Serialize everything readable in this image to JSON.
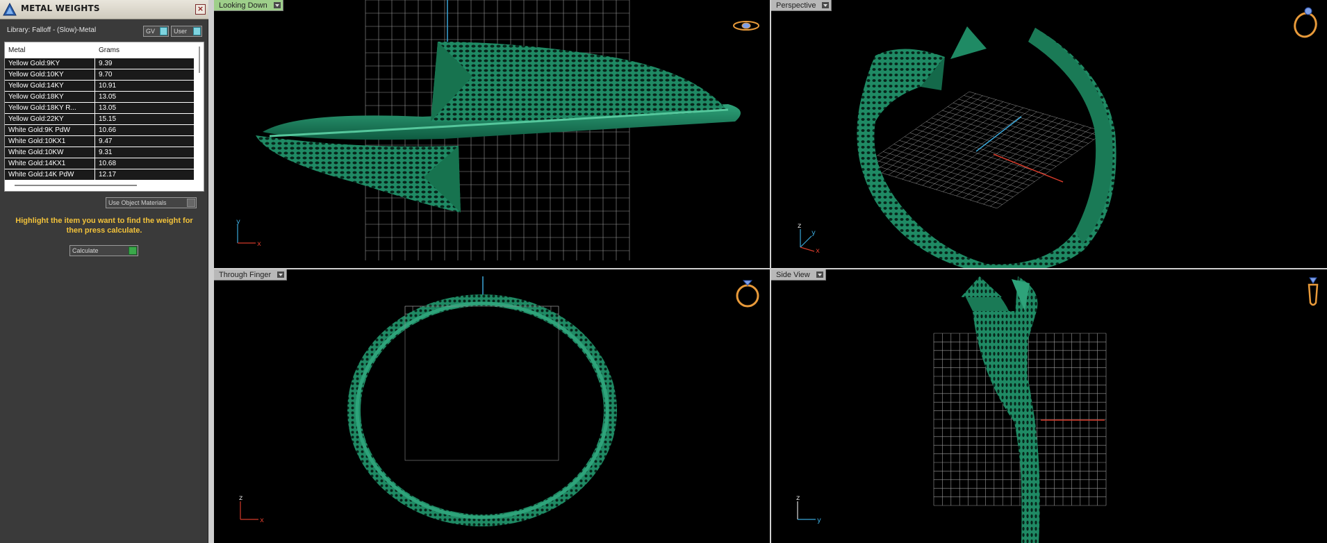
{
  "panel": {
    "title": "METAL WEIGHTS",
    "close": "×",
    "library_label": "Library: Falloff - (Slow)-Metal",
    "toggle_gv": "GV",
    "toggle_user": "User",
    "table": {
      "columns": [
        "Metal",
        "Grams"
      ],
      "rows": [
        {
          "metal": "Yellow Gold:9KY",
          "grams": "9.39"
        },
        {
          "metal": "Yellow Gold:10KY",
          "grams": "9.70"
        },
        {
          "metal": "Yellow Gold:14KY",
          "grams": "10.91"
        },
        {
          "metal": "Yellow Gold:18KY",
          "grams": "13.05"
        },
        {
          "metal": "Yellow Gold:18KY R...",
          "grams": "13.05"
        },
        {
          "metal": "Yellow Gold:22KY",
          "grams": "15.15"
        },
        {
          "metal": "White Gold:9K PdW",
          "grams": "10.66"
        },
        {
          "metal": "White Gold:10KX1",
          "grams": "9.47"
        },
        {
          "metal": "White Gold:10KW",
          "grams": "9.31"
        },
        {
          "metal": "White Gold:14KX1",
          "grams": "10.68"
        },
        {
          "metal": "White Gold:14K PdW",
          "grams": "12.17"
        }
      ]
    },
    "use_object_materials": "Use Object Materials",
    "hint": "Highlight the item you want to find the weight for then press calculate.",
    "calculate": "Calculate"
  },
  "viewports": {
    "top_left": {
      "label": "Looking Down",
      "axis_a": "y",
      "axis_b": "x",
      "icon": "ring-top-icon"
    },
    "top_right": {
      "label": "Perspective",
      "axis_a": "z",
      "axis_b": "y",
      "axis_c": "x",
      "icon": "ring-perspective-icon"
    },
    "bottom_left": {
      "label": "Through Finger",
      "axis_a": "z",
      "axis_b": "x",
      "icon": "ring-front-icon"
    },
    "bottom_right": {
      "label": "Side View",
      "axis_a": "z",
      "axis_b": "y",
      "icon": "ring-side-icon"
    }
  },
  "colors": {
    "model": "#1f8a64",
    "model_dark": "#0b3f2c",
    "grid": "#9a9a9a",
    "axis_blue": "#3aa6d8",
    "axis_red": "#d23a2a",
    "active_tab": "#9ecf8a",
    "hint": "#f2c23a",
    "icon_orange": "#e89a3a"
  }
}
